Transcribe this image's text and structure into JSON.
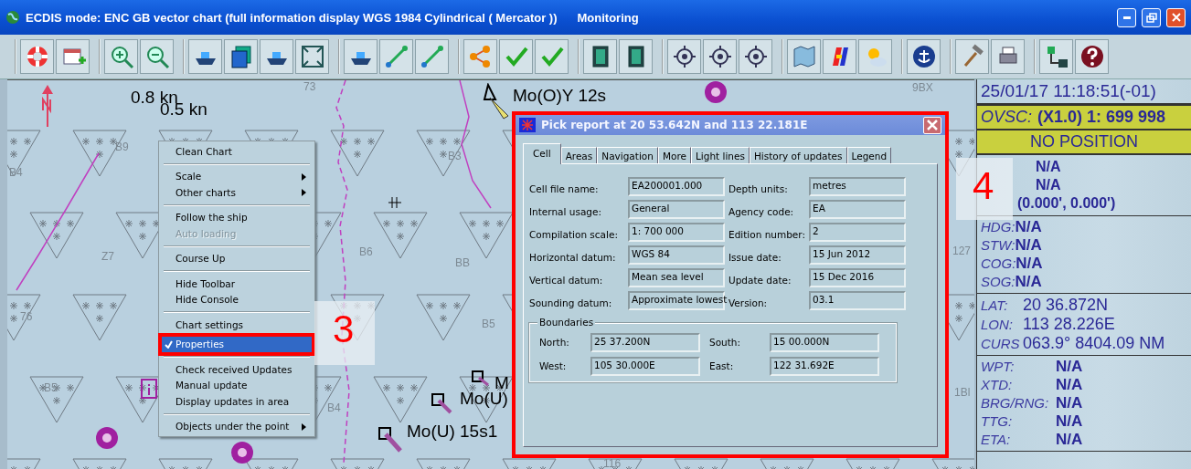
{
  "window": {
    "title": "ECDIS mode: ENC GB vector chart (full information display  WGS 1984  Cylindrical ( Mercator ))",
    "mode": "Monitoring"
  },
  "chart": {
    "labels": [
      {
        "text": "0.8 kn",
        "kind": "big"
      },
      {
        "text": "0.5 kn",
        "kind": "big"
      },
      {
        "text": "Mo(O)Y 12s",
        "kind": "big"
      },
      {
        "text": "M",
        "kind": "big"
      },
      {
        "text": "Mo(U)",
        "kind": "big"
      },
      {
        "text": "Mo(U) 15s1",
        "kind": "big"
      },
      {
        "text": "73",
        "kind": "sounding"
      },
      {
        "text": "B9",
        "kind": "sounding"
      },
      {
        "text": "B4",
        "kind": "sounding"
      },
      {
        "text": "B3",
        "kind": "sounding"
      },
      {
        "text": "Z7",
        "kind": "sounding"
      },
      {
        "text": "B6",
        "kind": "sounding"
      },
      {
        "text": "BB",
        "kind": "sounding"
      },
      {
        "text": "76",
        "kind": "sounding"
      },
      {
        "text": "B5",
        "kind": "sounding"
      },
      {
        "text": "B5",
        "kind": "sounding"
      },
      {
        "text": "B4",
        "kind": "sounding"
      },
      {
        "text": "9BX",
        "kind": "sounding"
      },
      {
        "text": "127",
        "kind": "sounding"
      },
      {
        "text": "1Bl",
        "kind": "sounding"
      },
      {
        "text": "116",
        "kind": "sounding"
      }
    ]
  },
  "context_menu": {
    "items": [
      {
        "kind": "item",
        "label": "Clean Chart",
        "disabled": false,
        "selected": false,
        "submenu": false
      },
      {
        "kind": "separator"
      },
      {
        "kind": "item",
        "label": "Scale",
        "disabled": false,
        "selected": false,
        "submenu": true
      },
      {
        "kind": "item",
        "label": "Other charts",
        "disabled": false,
        "selected": false,
        "submenu": true
      },
      {
        "kind": "separator"
      },
      {
        "kind": "item",
        "label": "Follow the ship",
        "disabled": false,
        "selected": false,
        "submenu": false
      },
      {
        "kind": "item",
        "label": "Auto loading",
        "disabled": true,
        "selected": false,
        "submenu": false
      },
      {
        "kind": "separator"
      },
      {
        "kind": "item",
        "label": "Course Up",
        "disabled": false,
        "selected": false,
        "submenu": false
      },
      {
        "kind": "separator"
      },
      {
        "kind": "item",
        "label": "Hide Toolbar",
        "disabled": false,
        "selected": false,
        "submenu": false
      },
      {
        "kind": "item",
        "label": "Hide Console",
        "disabled": false,
        "selected": false,
        "submenu": false
      },
      {
        "kind": "separator"
      },
      {
        "kind": "item",
        "label": "Chart settings",
        "disabled": false,
        "selected": false,
        "submenu": false
      },
      {
        "kind": "item",
        "label": "Properties",
        "disabled": false,
        "selected": true,
        "checked": true,
        "submenu": false
      },
      {
        "kind": "separator"
      },
      {
        "kind": "item",
        "label": "Check received Updates",
        "disabled": false,
        "selected": false,
        "submenu": false
      },
      {
        "kind": "item",
        "label": "Manual update",
        "disabled": false,
        "selected": false,
        "submenu": false
      },
      {
        "kind": "item",
        "label": "Display updates in area",
        "disabled": false,
        "selected": false,
        "submenu": false
      },
      {
        "kind": "separator"
      },
      {
        "kind": "item",
        "label": "Objects under the point",
        "disabled": false,
        "selected": false,
        "submenu": true
      }
    ]
  },
  "annotations": [
    {
      "text": "3"
    },
    {
      "text": "4"
    }
  ],
  "dialog": {
    "title": "Pick report at 20 53.642N and 113 22.181E",
    "tabs": [
      {
        "label": "Cell",
        "selected": true
      },
      {
        "label": "Areas",
        "selected": false
      },
      {
        "label": "Navigation",
        "selected": false
      },
      {
        "label": "More",
        "selected": false
      },
      {
        "label": "Light lines",
        "selected": false
      },
      {
        "label": "History of updates",
        "selected": false
      },
      {
        "label": "Legend",
        "selected": false
      }
    ],
    "fields": [
      {
        "label": "Cell file name:",
        "value": "EA200001.000"
      },
      {
        "label": "Depth units:",
        "value": "metres"
      },
      {
        "label": "Internal usage:",
        "value": "General"
      },
      {
        "label": "Agency code:",
        "value": "EA"
      },
      {
        "label": "Compilation scale:",
        "value": "1:    700 000"
      },
      {
        "label": "Edition number:",
        "value": "2"
      },
      {
        "label": "Horizontal datum:",
        "value": "WGS 84"
      },
      {
        "label": "Issue date:",
        "value": "15 Jun 2012"
      },
      {
        "label": "Vertical datum:",
        "value": "Mean sea level"
      },
      {
        "label": "Update date:",
        "value": "15 Dec 2016"
      },
      {
        "label": "Sounding datum:",
        "value": "Approximate lowest"
      },
      {
        "label": "Version:",
        "value": "03.1"
      }
    ],
    "boundaries": {
      "title": "Boundaries",
      "fields": [
        {
          "label": "North:",
          "value": "25 37.200N"
        },
        {
          "label": "South:",
          "value": "15 00.000N"
        },
        {
          "label": "West:",
          "value": "105 30.000E"
        },
        {
          "label": "East:",
          "value": "122 31.692E"
        }
      ]
    }
  },
  "console": {
    "datetime": "25/01/17 11:18:51(-01)",
    "scale": {
      "label": "OVSC:",
      "value": "(X1.0) 1:   699 998"
    },
    "status": "NO POSITION",
    "position_lines": [
      "N/A",
      "N/A",
      "(0.000', 0.000')"
    ],
    "sensors": [
      {
        "label": "HDG:",
        "value": "N/A"
      },
      {
        "label": "STW:",
        "value": "N/A"
      },
      {
        "label": "COG:",
        "value": "N/A"
      },
      {
        "label": "SOG:",
        "value": "N/A"
      }
    ],
    "position": [
      {
        "label": "LAT:",
        "value": "20 36.872N"
      },
      {
        "label": "LON:",
        "value": "113 28.226E"
      },
      {
        "label": "CURS",
        "value": "063.9° 8404.09 NM"
      }
    ],
    "route": [
      {
        "label": "WPT:",
        "value": "N/A"
      },
      {
        "label": "XTD:",
        "value": "N/A"
      },
      {
        "label": "BRG/RNG:",
        "value": "N/A"
      },
      {
        "label": "TTG:",
        "value": "N/A"
      },
      {
        "label": "ETA:",
        "value": "N/A"
      }
    ]
  }
}
